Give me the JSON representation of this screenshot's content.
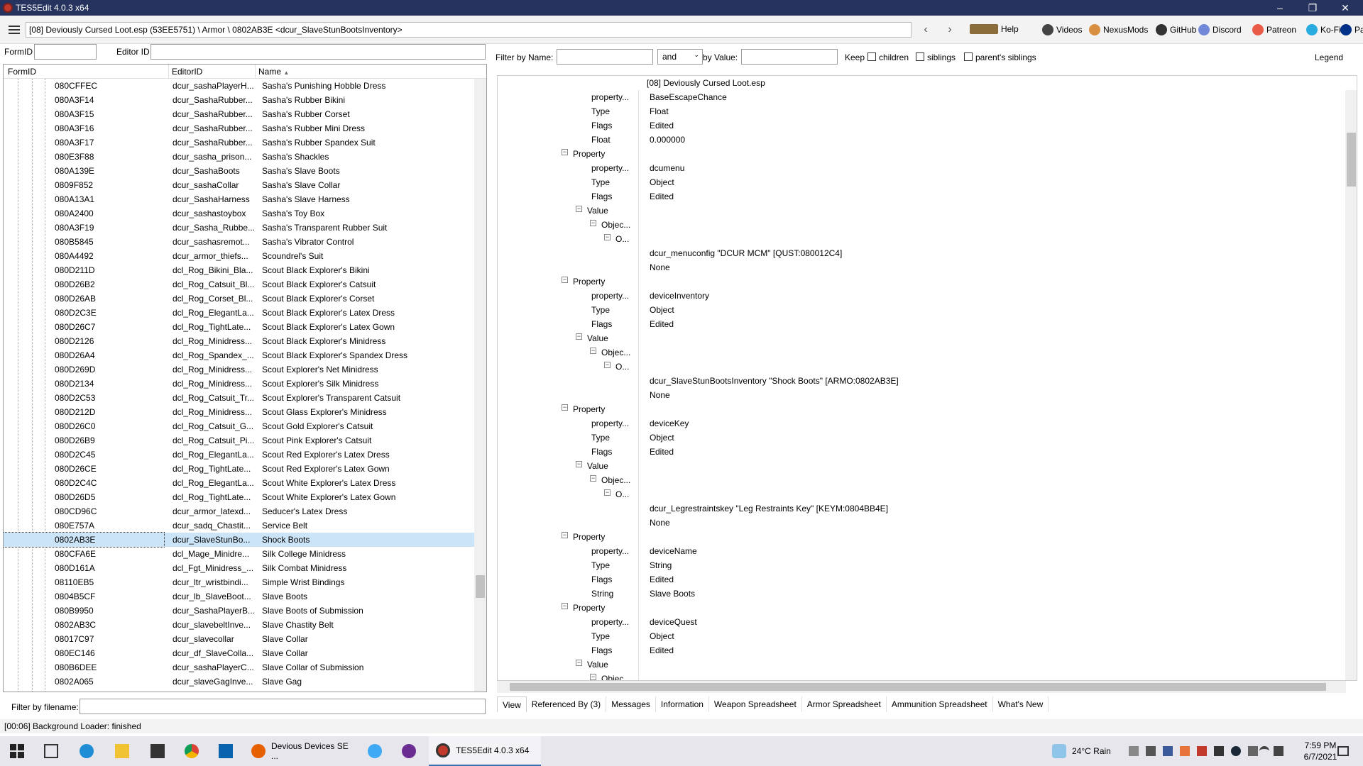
{
  "window": {
    "title": "TES5Edit 4.0.3 x64",
    "min": "–",
    "max": "❐",
    "close": "✕"
  },
  "toolbar": {
    "path": "[08] Deviously Cursed Loot.esp (53EE5751) \\ Armor \\ 0802AB3E <dcur_SlaveStunBootsInventory>",
    "back": "‹",
    "forward": "›",
    "links": [
      {
        "label": "Help",
        "icon": "book-icon",
        "color": "#8a6d3b"
      },
      {
        "label": "Videos",
        "icon": "videos-icon",
        "color": "#444444"
      },
      {
        "label": "NexusMods",
        "icon": "nexusmods-icon",
        "color": "#d98f40"
      },
      {
        "label": "GitHub",
        "icon": "github-icon",
        "color": "#333333"
      },
      {
        "label": "Discord",
        "icon": "discord-icon",
        "color": "#7289da"
      },
      {
        "label": "Patreon",
        "icon": "patreon-icon",
        "color": "#e85b46"
      },
      {
        "label": "Ko-Fi",
        "icon": "kofi-icon",
        "color": "#29abe0"
      },
      {
        "label": "PayPal",
        "icon": "paypal-icon",
        "color": "#003087"
      }
    ]
  },
  "filters": {
    "formid_label": "FormID",
    "editorid_label": "Editor ID",
    "filter_name_label": "Filter by Name:",
    "and_value": "and",
    "by_value_label": "by Value:",
    "keep_label": "Keep",
    "children": "children",
    "siblings": "siblings",
    "parents": "parent's siblings",
    "legend": "Legend"
  },
  "list": {
    "headers": {
      "formid": "FormID",
      "editorid": "EditorID",
      "name": "Name"
    },
    "sort_arrow": "▲",
    "rows": [
      {
        "id": "080CFFEC",
        "eid": "dcur_sashaPlayerH...",
        "name": "Sasha's Punishing Hobble Dress"
      },
      {
        "id": "080A3F14",
        "eid": "dcur_SashaRubber...",
        "name": "Sasha's Rubber Bikini"
      },
      {
        "id": "080A3F15",
        "eid": "dcur_SashaRubber...",
        "name": "Sasha's Rubber Corset"
      },
      {
        "id": "080A3F16",
        "eid": "dcur_SashaRubber...",
        "name": "Sasha's Rubber Mini Dress"
      },
      {
        "id": "080A3F17",
        "eid": "dcur_SashaRubber...",
        "name": "Sasha's Rubber Spandex Suit"
      },
      {
        "id": "080E3F88",
        "eid": "dcur_sasha_prison...",
        "name": "Sasha's Shackles"
      },
      {
        "id": "080A139E",
        "eid": "dcur_SashaBoots",
        "name": "Sasha's Slave Boots"
      },
      {
        "id": "0809F852",
        "eid": "dcur_sashaCollar",
        "name": "Sasha's Slave Collar"
      },
      {
        "id": "080A13A1",
        "eid": "dcur_SashaHarness",
        "name": "Sasha's Slave Harness"
      },
      {
        "id": "080A2400",
        "eid": "dcur_sashastoybox",
        "name": "Sasha's Toy Box"
      },
      {
        "id": "080A3F19",
        "eid": "dcur_Sasha_Rubbe...",
        "name": "Sasha's Transparent Rubber Suit"
      },
      {
        "id": "080B5845",
        "eid": "dcur_sashasremot...",
        "name": "Sasha's Vibrator Control"
      },
      {
        "id": "080A4492",
        "eid": "dcur_armor_thiefs...",
        "name": "Scoundrel's Suit"
      },
      {
        "id": "080D211D",
        "eid": "dcl_Rog_Bikini_Bla...",
        "name": "Scout Black Explorer's Bikini"
      },
      {
        "id": "080D26B2",
        "eid": "dcl_Rog_Catsuit_Bl...",
        "name": "Scout Black Explorer's Catsuit"
      },
      {
        "id": "080D26AB",
        "eid": "dcl_Rog_Corset_Bl...",
        "name": "Scout Black Explorer's Corset"
      },
      {
        "id": "080D2C3E",
        "eid": "dcl_Rog_ElegantLa...",
        "name": "Scout Black Explorer's Latex Dress"
      },
      {
        "id": "080D26C7",
        "eid": "dcl_Rog_TightLate...",
        "name": "Scout Black Explorer's Latex Gown"
      },
      {
        "id": "080D2126",
        "eid": "dcl_Rog_Minidress...",
        "name": "Scout Black Explorer's Minidress"
      },
      {
        "id": "080D26A4",
        "eid": "dcl_Rog_Spandex_...",
        "name": "Scout Black Explorer's Spandex Dress"
      },
      {
        "id": "080D269D",
        "eid": "dcl_Rog_Minidress...",
        "name": "Scout Explorer's Net Minidress"
      },
      {
        "id": "080D2134",
        "eid": "dcl_Rog_Minidress...",
        "name": "Scout Explorer's Silk Minidress"
      },
      {
        "id": "080D2C53",
        "eid": "dcl_Rog_Catsuit_Tr...",
        "name": "Scout Explorer's Transparent Catsuit"
      },
      {
        "id": "080D212D",
        "eid": "dcl_Rog_Minidress...",
        "name": "Scout Glass Explorer's Minidress"
      },
      {
        "id": "080D26C0",
        "eid": "dcl_Rog_Catsuit_G...",
        "name": "Scout Gold Explorer's Catsuit"
      },
      {
        "id": "080D26B9",
        "eid": "dcl_Rog_Catsuit_Pi...",
        "name": "Scout Pink Explorer's Catsuit"
      },
      {
        "id": "080D2C45",
        "eid": "dcl_Rog_ElegantLa...",
        "name": "Scout Red Explorer's Latex Dress"
      },
      {
        "id": "080D26CE",
        "eid": "dcl_Rog_TightLate...",
        "name": "Scout Red Explorer's Latex Gown"
      },
      {
        "id": "080D2C4C",
        "eid": "dcl_Rog_ElegantLa...",
        "name": "Scout White Explorer's Latex Dress"
      },
      {
        "id": "080D26D5",
        "eid": "dcl_Rog_TightLate...",
        "name": "Scout White Explorer's Latex Gown"
      },
      {
        "id": "080CD96C",
        "eid": "dcur_armor_latexd...",
        "name": "Seducer's Latex Dress"
      },
      {
        "id": "080E757A",
        "eid": "dcur_sadq_Chastit...",
        "name": "Service Belt"
      },
      {
        "id": "0802AB3E",
        "eid": "dcur_SlaveStunBo...",
        "name": "Shock Boots",
        "selected": true
      },
      {
        "id": "080CFA6E",
        "eid": "dcl_Mage_Minidre...",
        "name": "Silk College Minidress"
      },
      {
        "id": "080D161A",
        "eid": "dcl_Fgt_Minidress_...",
        "name": "Silk Combat Minidress"
      },
      {
        "id": "08110EB5",
        "eid": "dcur_ltr_wristbindi...",
        "name": "Simple Wrist Bindings"
      },
      {
        "id": "0804B5CF",
        "eid": "dcur_lb_SlaveBoot...",
        "name": "Slave Boots"
      },
      {
        "id": "080B9950",
        "eid": "dcur_SashaPlayerB...",
        "name": "Slave Boots of Submission"
      },
      {
        "id": "0802AB3C",
        "eid": "dcur_slavebeltInve...",
        "name": "Slave Chastity Belt"
      },
      {
        "id": "08017C97",
        "eid": "dcur_slavecollar",
        "name": "Slave Collar"
      },
      {
        "id": "080EC146",
        "eid": "dcur_df_SlaveColla...",
        "name": "Slave Collar"
      },
      {
        "id": "080B6DEE",
        "eid": "dcur_sashaPlayerC...",
        "name": "Slave Collar of Submission"
      },
      {
        "id": "0802A065",
        "eid": "dcur_slaveGagInve...",
        "name": "Slave Gag"
      }
    ],
    "filename_label": "Filter by filename:"
  },
  "detail": {
    "header": "[08] Deviously Cursed Loot.esp",
    "rows": [
      {
        "k": "property...",
        "v": "BaseEscapeChance",
        "lvl": 3
      },
      {
        "k": "Type",
        "v": "Float",
        "lvl": 3
      },
      {
        "k": "Flags",
        "v": "Edited",
        "lvl": 3
      },
      {
        "k": "Float",
        "v": "0.000000",
        "lvl": 3
      },
      {
        "k": "Property",
        "v": "",
        "lvl": 2,
        "exp": true
      },
      {
        "k": "property...",
        "v": "dcumenu",
        "lvl": 3
      },
      {
        "k": "Type",
        "v": "Object",
        "lvl": 3
      },
      {
        "k": "Flags",
        "v": "Edited",
        "lvl": 3
      },
      {
        "k": "Value",
        "v": "",
        "lvl": 3,
        "exp": true
      },
      {
        "k": "Objec...",
        "v": "",
        "lvl": 4,
        "exp": true
      },
      {
        "k": "O...",
        "v": "",
        "lvl": 5,
        "exp": true
      },
      {
        "k": "",
        "v": "dcur_menuconfig \"DCUR MCM\" [QUST:080012C4]",
        "lvl": 6
      },
      {
        "k": "",
        "v": "None",
        "lvl": 6
      },
      {
        "k": "Property",
        "v": "",
        "lvl": 2,
        "exp": true
      },
      {
        "k": "property...",
        "v": "deviceInventory",
        "lvl": 3
      },
      {
        "k": "Type",
        "v": "Object",
        "lvl": 3
      },
      {
        "k": "Flags",
        "v": "Edited",
        "lvl": 3
      },
      {
        "k": "Value",
        "v": "",
        "lvl": 3,
        "exp": true
      },
      {
        "k": "Objec...",
        "v": "",
        "lvl": 4,
        "exp": true
      },
      {
        "k": "O...",
        "v": "",
        "lvl": 5,
        "exp": true
      },
      {
        "k": "",
        "v": "dcur_SlaveStunBootsInventory \"Shock Boots\" [ARMO:0802AB3E]",
        "lvl": 6
      },
      {
        "k": "",
        "v": "None",
        "lvl": 6
      },
      {
        "k": "Property",
        "v": "",
        "lvl": 2,
        "exp": true
      },
      {
        "k": "property...",
        "v": "deviceKey",
        "lvl": 3
      },
      {
        "k": "Type",
        "v": "Object",
        "lvl": 3
      },
      {
        "k": "Flags",
        "v": "Edited",
        "lvl": 3
      },
      {
        "k": "Value",
        "v": "",
        "lvl": 3,
        "exp": true
      },
      {
        "k": "Objec...",
        "v": "",
        "lvl": 4,
        "exp": true
      },
      {
        "k": "O...",
        "v": "",
        "lvl": 5,
        "exp": true
      },
      {
        "k": "",
        "v": "dcur_Legrestraintskey \"Leg Restraints Key\" [KEYM:0804BB4E]",
        "lvl": 6
      },
      {
        "k": "",
        "v": "None",
        "lvl": 6
      },
      {
        "k": "Property",
        "v": "",
        "lvl": 2,
        "exp": true
      },
      {
        "k": "property...",
        "v": "deviceName",
        "lvl": 3
      },
      {
        "k": "Type",
        "v": "String",
        "lvl": 3
      },
      {
        "k": "Flags",
        "v": "Edited",
        "lvl": 3
      },
      {
        "k": "String",
        "v": "Slave Boots",
        "lvl": 3
      },
      {
        "k": "Property",
        "v": "",
        "lvl": 2,
        "exp": true
      },
      {
        "k": "property...",
        "v": "deviceQuest",
        "lvl": 3
      },
      {
        "k": "Type",
        "v": "Object",
        "lvl": 3
      },
      {
        "k": "Flags",
        "v": "Edited",
        "lvl": 3
      },
      {
        "k": "Value",
        "v": "",
        "lvl": 3,
        "exp": true
      },
      {
        "k": "Objec...",
        "v": "",
        "lvl": 4,
        "exp": true
      }
    ]
  },
  "tabs": [
    "View",
    "Referenced By (3)",
    "Messages",
    "Information",
    "Weapon Spreadsheet",
    "Armor Spreadsheet",
    "Ammunition Spreadsheet",
    "What's New"
  ],
  "status": "[00:06] Background Loader: finished",
  "taskbar": {
    "firefox_label": "Devious Devices SE ...",
    "tes5_label": "TES5Edit 4.0.3 x64",
    "weather": "24°C  Rain",
    "time": "7:59 PM",
    "date": "6/7/2021"
  }
}
